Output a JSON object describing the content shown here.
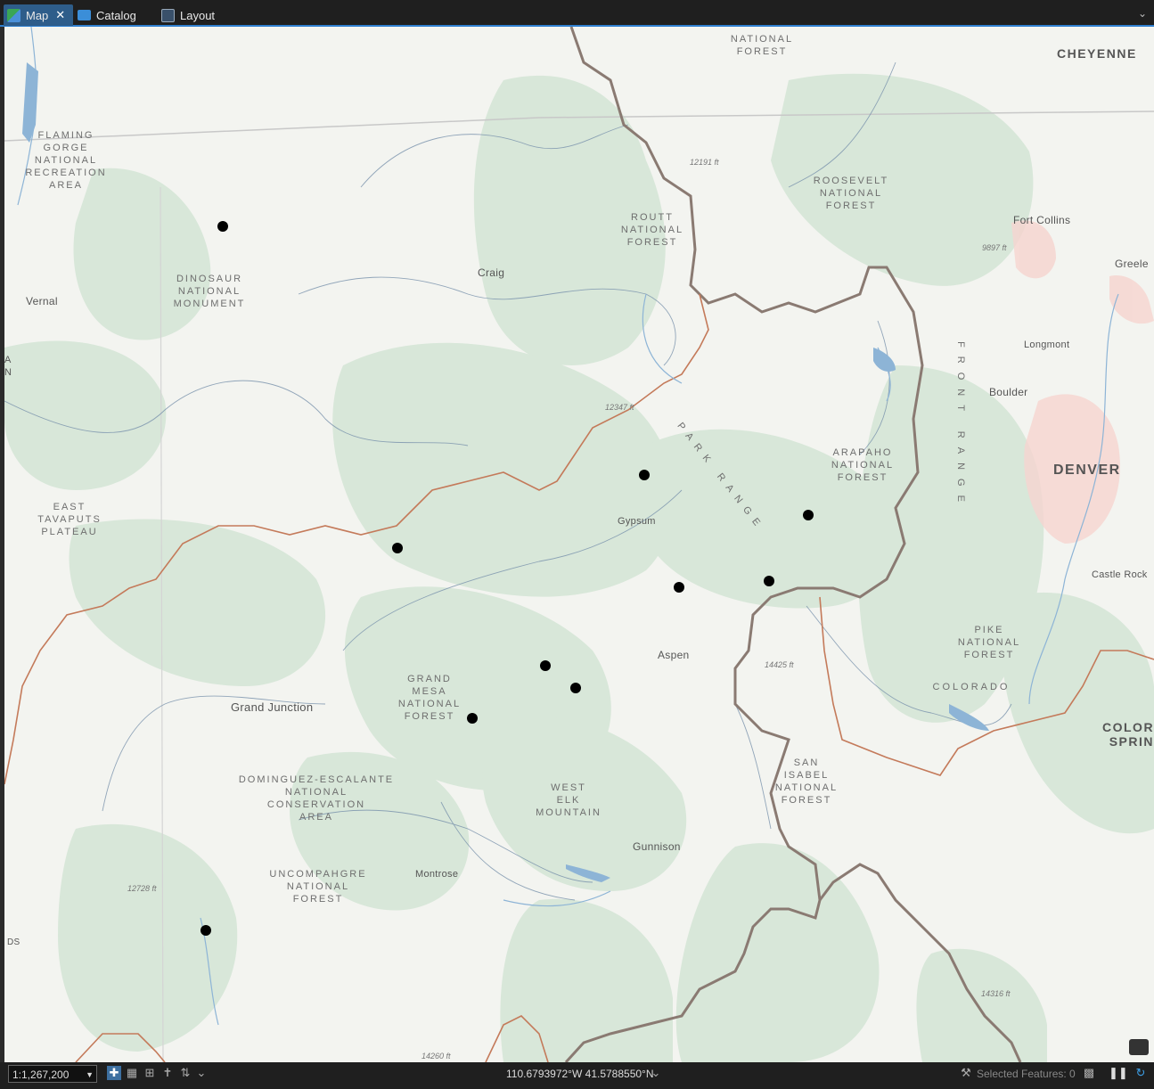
{
  "tabs": [
    {
      "label": "Map",
      "close": "✕",
      "active": true
    },
    {
      "label": "Catalog",
      "active": false
    },
    {
      "label": "Layout",
      "active": false
    }
  ],
  "map": {
    "areas": [
      {
        "id": "flaming-gorge",
        "text": "FLAMING\nGORGE\nNATIONAL\nRECREATION\nAREA"
      },
      {
        "id": "dinosaur",
        "text": "DINOSAUR\nNATIONAL\nMONUMENT"
      },
      {
        "id": "routt",
        "text": "ROUTT\nNATIONAL\nFOREST"
      },
      {
        "id": "roosevelt",
        "text": "ROOSEVELT\nNATIONAL\nFOREST"
      },
      {
        "id": "national-forest-top",
        "text": "NATIONAL\nFOREST"
      },
      {
        "id": "arapaho",
        "text": "ARAPAHO\nNATIONAL\nFOREST"
      },
      {
        "id": "east-tavaputs",
        "text": "EAST\nTAVAPUTS\nPLATEAU"
      },
      {
        "id": "grand-mesa",
        "text": "GRAND\nMESA\nNATIONAL\nFOREST"
      },
      {
        "id": "pike",
        "text": "PIKE\nNATIONAL\nFOREST"
      },
      {
        "id": "colorado",
        "text": "COLORADO"
      },
      {
        "id": "dominguez",
        "text": "DOMINGUEZ-ESCALANTE\nNATIONAL\nCONSERVATION\nAREA"
      },
      {
        "id": "san-isabel",
        "text": "SAN\nISABEL\nNATIONAL\nFOREST"
      },
      {
        "id": "west-elk",
        "text": "WEST\nELK\nMOUNTAIN"
      },
      {
        "id": "uncompahgre",
        "text": "UNCOMPAHGRE\nNATIONAL\nFOREST"
      },
      {
        "id": "park-range",
        "text": "PARK RANGE"
      },
      {
        "id": "front-range",
        "text": "FRONT RANGE"
      }
    ],
    "cities": [
      {
        "id": "cheyenne",
        "text": "CHEYENNE"
      },
      {
        "id": "fort-collins",
        "text": "Fort Collins"
      },
      {
        "id": "greeley",
        "text": "Greele"
      },
      {
        "id": "longmont",
        "text": "Longmont"
      },
      {
        "id": "boulder",
        "text": "Boulder"
      },
      {
        "id": "denver",
        "text": "DENVER"
      },
      {
        "id": "castle-rock",
        "text": "Castle Rock"
      },
      {
        "id": "colorado-springs",
        "text": "COLORA\nSPRIN"
      },
      {
        "id": "vernal",
        "text": "Vernal"
      },
      {
        "id": "craig",
        "text": "Craig"
      },
      {
        "id": "gypsum",
        "text": "Gypsum"
      },
      {
        "id": "aspen",
        "text": "Aspen"
      },
      {
        "id": "grand-junction",
        "text": "Grand Junction"
      },
      {
        "id": "gunnison",
        "text": "Gunnison"
      },
      {
        "id": "montrose",
        "text": "Montrose"
      },
      {
        "id": "left-a",
        "text": "A\nN"
      },
      {
        "id": "left-ds",
        "text": "DS"
      }
    ],
    "elevations": [
      "12191 ft",
      "9897 ft",
      "12347 ft",
      "14425 ft",
      "12728 ft",
      "14316 ft",
      "14260 ft"
    ]
  },
  "status": {
    "scale": "1:1,267,200",
    "coordinates": "110.6793972°W 41.5788550°N",
    "selected_features": "Selected Features: 0"
  },
  "colors": {
    "accent": "#2f7fd0",
    "statusbar": "#1f1f1f",
    "map_bg": "#f3f4f0"
  }
}
